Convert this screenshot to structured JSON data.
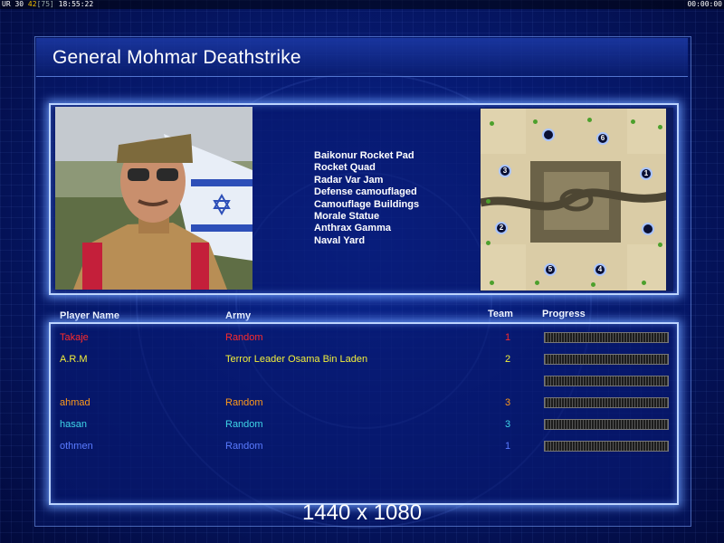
{
  "status_bar": {
    "left_prefix": "UR 30",
    "fps": "42",
    "fps_bracket": "[75]",
    "clock": "18:55:22",
    "timer": "00:00:00"
  },
  "title": "General Mohmar Deathstrike",
  "structures": [
    "Baikonur Rocket Pad",
    "Rocket Quad",
    "Radar Var Jam",
    "Defense camouflaged",
    "Camouflage Buildings",
    "Morale Statue",
    "Anthrax Gamma",
    "Naval Yard"
  ],
  "minimap": {
    "spots": [
      "",
      "6",
      "3",
      "1",
      "2",
      "",
      "5",
      "4"
    ]
  },
  "table": {
    "headers": {
      "player_name": "Player Name",
      "army": "Army",
      "team": "Team",
      "progress": "Progress"
    },
    "rows": [
      {
        "name": "Takaje",
        "army": "Random",
        "team": "1",
        "color": "#ff2a2a"
      },
      {
        "name": "A.R.M",
        "army": "Terror Leader Osama Bin Laden",
        "team": "2",
        "color": "#f2ef3a"
      },
      {
        "name": "",
        "army": "",
        "team": "",
        "color": "#ffffff"
      },
      {
        "name": "ahmad",
        "army": "Random",
        "team": "3",
        "color": "#ff9a1a"
      },
      {
        "name": "hasan",
        "army": "Random",
        "team": "3",
        "color": "#3fd6e8"
      },
      {
        "name": "othmen",
        "army": "Random",
        "team": "1",
        "color": "#5a7bff"
      }
    ]
  },
  "resolution_text": "1440 x 1080"
}
